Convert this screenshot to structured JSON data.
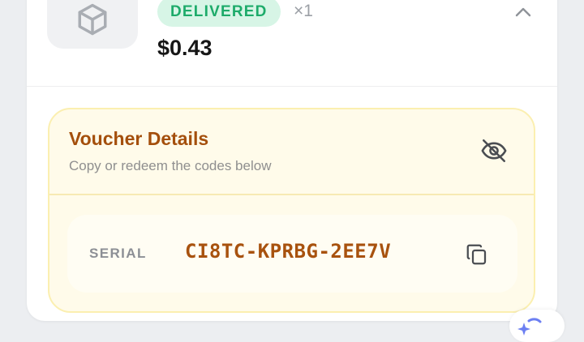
{
  "order_item": {
    "status_badge": "DELIVERED",
    "quantity": "×1",
    "price": "$0.43",
    "thumbnail_icon": "package-icon",
    "collapse_icon": "chevron-up-icon",
    "status_color": "#1dab6a"
  },
  "voucher": {
    "title": "Voucher Details",
    "subtitle": "Copy or redeem the codes below",
    "visibility_icon": "eye-off-icon",
    "serial_label": "SERIAL",
    "serial_code": "CI8TC-KPRBG-2EE7V",
    "copy_icon": "copy-icon",
    "accent_color": "#a44f0c"
  },
  "floating_button": {
    "icon": "assistant-icon"
  }
}
